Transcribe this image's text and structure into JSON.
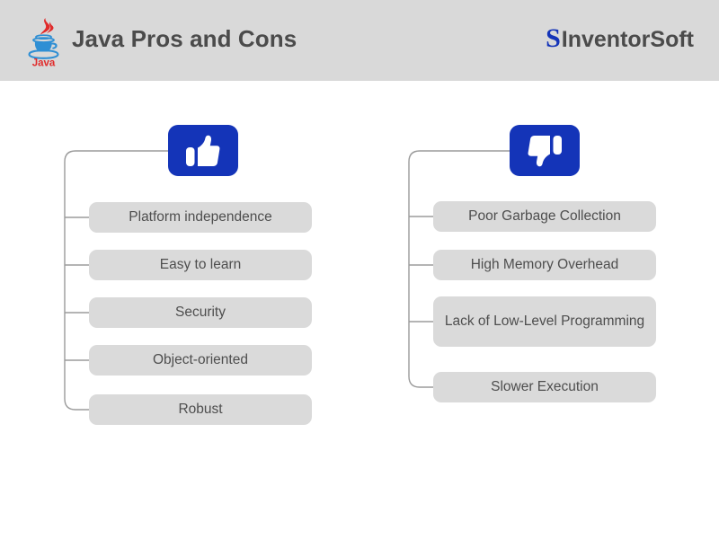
{
  "header": {
    "title": "Java Pros and Cons",
    "java_logo_icon": "java-logo-icon",
    "java_logo_wordmark": "Java",
    "brand_mark": "S",
    "brand_name": "InventorSoft",
    "background_color": "#d9d9d9",
    "title_color": "#4b4b4b",
    "brand_color": "#1434b8"
  },
  "theme": {
    "accent_blue": "#1434b8",
    "pill_background": "#dadada",
    "pill_text": "#4e4e4e",
    "connector_color": "#9b9b9b",
    "page_background": "#ffffff"
  },
  "columns": [
    {
      "id": "pros",
      "icon_name": "thumbs-up-icon",
      "icon_label": "Pros",
      "items": [
        {
          "label": "Platform independence"
        },
        {
          "label": "Easy to learn"
        },
        {
          "label": "Security"
        },
        {
          "label": "Object-oriented"
        },
        {
          "label": "Robust"
        }
      ]
    },
    {
      "id": "cons",
      "icon_name": "thumbs-down-icon",
      "icon_label": "Cons",
      "items": [
        {
          "label": "Poor Garbage Collection"
        },
        {
          "label": "High Memory Overhead"
        },
        {
          "label": "Lack of Low-Level Programming"
        },
        {
          "label": "Slower Execution"
        }
      ]
    }
  ]
}
